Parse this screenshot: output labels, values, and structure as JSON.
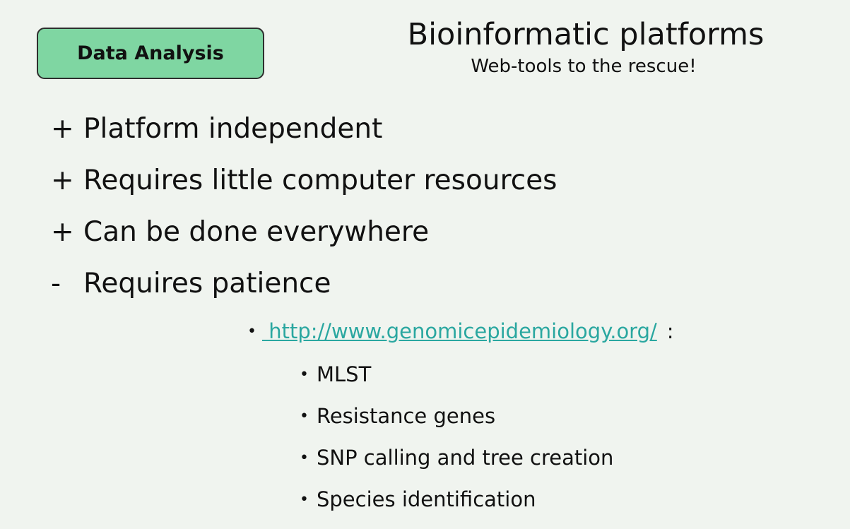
{
  "slide": {
    "badge": "Data Analysis",
    "title": "Bioinformatic platforms",
    "subtitle": "Web-tools to the rescue!",
    "points": [
      {
        "mark": "+",
        "text": "Platform independent"
      },
      {
        "mark": "+",
        "text": "Requires little computer resources"
      },
      {
        "mark": "+",
        "text": "Can be done everywhere"
      },
      {
        "mark": "-",
        "text": "Requires patience"
      }
    ],
    "link_text": " http://www.genomicepidemiology.org/",
    "link_suffix": ":",
    "subitems": [
      "MLST",
      "Resistance genes",
      "SNP calling and tree creation",
      "Species identification"
    ]
  },
  "colors": {
    "background": "#f0f4ef",
    "badge_fill": "#7fd6a2",
    "link": "#2aa7a0"
  }
}
